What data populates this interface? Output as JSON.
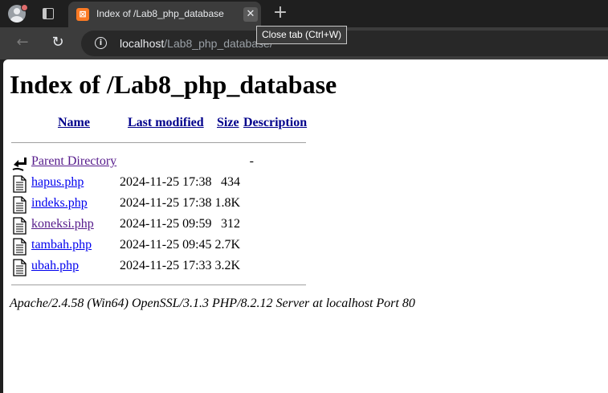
{
  "browser": {
    "tab_title": "Index of /Lab8_php_database",
    "favicon_glyph": "⊠",
    "new_tab_glyph": "+",
    "close_glyph": "✕",
    "tooltip": "Close tab (Ctrl+W)",
    "url_host": "localhost",
    "url_path": "/Lab8_php_database/",
    "colors": {
      "chrome_bg": "#1f1f1f",
      "toolbar_bg": "#3c3c3c",
      "favicon": "#fb7a24"
    }
  },
  "page": {
    "title": "Index of /Lab8_php_database",
    "columns": {
      "name": "Name",
      "last_modified": "Last modified",
      "size": "Size",
      "description": "Description"
    },
    "parent": {
      "name": "Parent Directory",
      "size": "-"
    },
    "files": [
      {
        "name": "hapus.php",
        "modified": "2024-11-25 17:38",
        "size": "434"
      },
      {
        "name": "indeks.php",
        "modified": "2024-11-25 17:38",
        "size": "1.8K"
      },
      {
        "name": "koneksi.php",
        "modified": "2024-11-25 09:59",
        "size": "312"
      },
      {
        "name": "tambah.php",
        "modified": "2024-11-25 09:45",
        "size": "2.7K"
      },
      {
        "name": "ubah.php",
        "modified": "2024-11-25 17:33",
        "size": "3.2K"
      }
    ],
    "footer": "Apache/2.4.58 (Win64) OpenSSL/3.1.3 PHP/8.2.12 Server at localhost Port 80"
  }
}
